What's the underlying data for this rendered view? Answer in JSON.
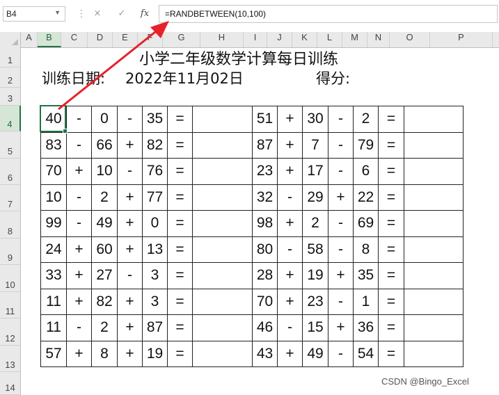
{
  "formula_bar": {
    "name_box": "B4",
    "cancel_icon": "×",
    "enter_icon": "✓",
    "fx_label": "fx",
    "formula": "=RANDBETWEEN(10,100)"
  },
  "columns": [
    "A",
    "B",
    "C",
    "D",
    "E",
    "F",
    "G",
    "H",
    "I",
    "J",
    "K",
    "L",
    "M",
    "N",
    "O",
    "P"
  ],
  "rows": [
    "1",
    "2",
    "3",
    "4",
    "5",
    "6",
    "7",
    "8",
    "9",
    "10",
    "11",
    "12",
    "13",
    "14"
  ],
  "sheet": {
    "title": "小学二年级数学计算每日训练",
    "date_label": "训练日期:",
    "date_value": "2022年11月02日",
    "score_label": "得分:"
  },
  "left_problems": [
    [
      "40",
      "-",
      "0",
      "-",
      "35",
      "="
    ],
    [
      "83",
      "-",
      "66",
      "+",
      "82",
      "="
    ],
    [
      "70",
      "+",
      "10",
      "-",
      "76",
      "="
    ],
    [
      "10",
      "-",
      "2",
      "+",
      "77",
      "="
    ],
    [
      "99",
      "-",
      "49",
      "+",
      "0",
      "="
    ],
    [
      "24",
      "+",
      "60",
      "+",
      "13",
      "="
    ],
    [
      "33",
      "+",
      "27",
      "-",
      "3",
      "="
    ],
    [
      "11",
      "+",
      "82",
      "+",
      "3",
      "="
    ],
    [
      "11",
      "-",
      "2",
      "+",
      "87",
      "="
    ],
    [
      "57",
      "+",
      "8",
      "+",
      "19",
      "="
    ]
  ],
  "right_problems": [
    [
      "51",
      "+",
      "30",
      "-",
      "2",
      "="
    ],
    [
      "87",
      "+",
      "7",
      "-",
      "79",
      "="
    ],
    [
      "23",
      "+",
      "17",
      "-",
      "6",
      "="
    ],
    [
      "32",
      "-",
      "29",
      "+",
      "22",
      "="
    ],
    [
      "98",
      "+",
      "2",
      "-",
      "69",
      "="
    ],
    [
      "80",
      "-",
      "58",
      "-",
      "8",
      "="
    ],
    [
      "28",
      "+",
      "19",
      "+",
      "35",
      "="
    ],
    [
      "70",
      "+",
      "23",
      "-",
      "1",
      "="
    ],
    [
      "46",
      "-",
      "15",
      "+",
      "36",
      "="
    ],
    [
      "43",
      "+",
      "49",
      "-",
      "54",
      "="
    ]
  ],
  "watermark": "CSDN @Bingo_Excel",
  "colors": {
    "selection": "#217346",
    "arrow": "#e8202a",
    "header_bg": "#e9e9e9"
  }
}
